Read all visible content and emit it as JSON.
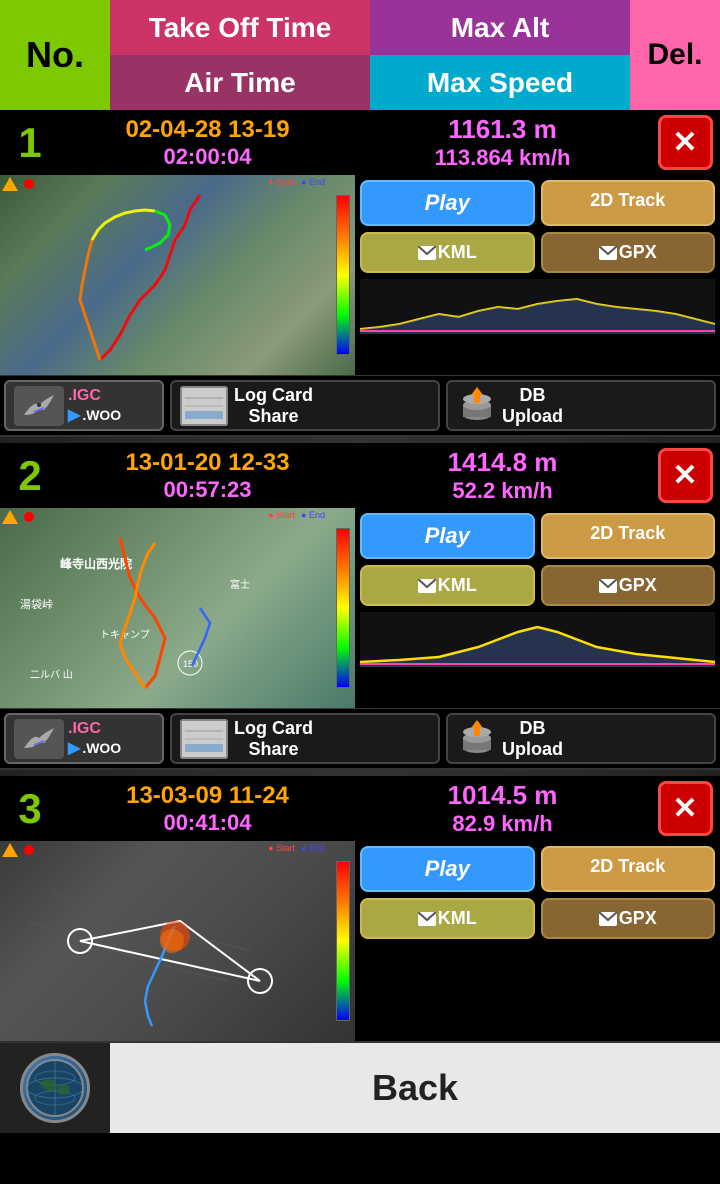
{
  "header": {
    "no_label": "No.",
    "takeoff_label": "Take Off Time",
    "airtime_label": "Air Time",
    "maxalt_label": "Max Alt",
    "maxspeed_label": "Max Speed",
    "del_label": "Del."
  },
  "flights": [
    {
      "num": "1",
      "datetime": "02-04-28 13-19",
      "airtime": "02:00:04",
      "max_alt": "1161.3 m",
      "max_speed": "113.864 km/h",
      "buttons": {
        "play": "Play",
        "track2d": "2D Track",
        "kml": "KML",
        "gpx": "GPX"
      },
      "action": {
        "igc": ".IGC",
        "woo": ".WOO",
        "logcard": "Log Card\nShare",
        "dbupload": "DB\nUpload"
      }
    },
    {
      "num": "2",
      "datetime": "13-01-20 12-33",
      "airtime": "00:57:23",
      "max_alt": "1414.8 m",
      "max_speed": "52.2 km/h",
      "buttons": {
        "play": "Play",
        "track2d": "2D Track",
        "kml": "KML",
        "gpx": "GPX"
      },
      "action": {
        "igc": ".IGC",
        "woo": ".WOO",
        "logcard": "Log Card\nShare",
        "dbupload": "DB\nUpload"
      }
    },
    {
      "num": "3",
      "datetime": "13-03-09 11-24",
      "airtime": "00:41:04",
      "max_alt": "1014.5 m",
      "max_speed": "82.9 km/h",
      "buttons": {
        "play": "Play",
        "track2d": "2D Track",
        "kml": "KML",
        "gpx": "GPX"
      }
    }
  ],
  "footer": {
    "back_label": "Back"
  }
}
